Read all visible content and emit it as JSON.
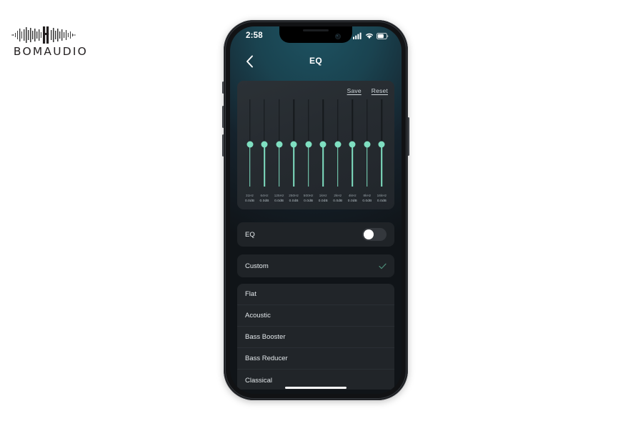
{
  "brand": {
    "name": "BOMAUDIO",
    "logo_icon": "audio-waveform-icon"
  },
  "phone": {
    "status_bar": {
      "time": "2:58",
      "icons": [
        "cellular-signal-icon",
        "wifi-icon",
        "battery-icon"
      ]
    },
    "nav": {
      "back_icon": "chevron-left-icon",
      "title": "EQ"
    }
  },
  "eq_panel": {
    "actions": [
      {
        "label": "Save",
        "name": "save-button"
      },
      {
        "label": "Reset",
        "name": "reset-button"
      }
    ],
    "thumb_color": "#7fdfc1",
    "track_active_color": "#7fdfc1",
    "track_inactive_color": "#15191c",
    "bands": [
      {
        "freq": "31Hz",
        "gain": "0.0dB",
        "value": 0
      },
      {
        "freq": "64Hz",
        "gain": "0.0dB",
        "value": 0
      },
      {
        "freq": "125Hz",
        "gain": "0.0dB",
        "value": 0
      },
      {
        "freq": "250Hz",
        "gain": "0.0dB",
        "value": 0
      },
      {
        "freq": "500Hz",
        "gain": "0.0dB",
        "value": 0
      },
      {
        "freq": "1kHz",
        "gain": "0.0dB",
        "value": 0
      },
      {
        "freq": "2kHz",
        "gain": "0.0dB",
        "value": 0
      },
      {
        "freq": "4kHz",
        "gain": "0.0dB",
        "value": 0
      },
      {
        "freq": "8kHz",
        "gain": "0.0dB",
        "value": 0
      },
      {
        "freq": "16kHz",
        "gain": "0.0dB",
        "value": 0
      }
    ]
  },
  "eq_toggle": {
    "label": "EQ",
    "state": "off"
  },
  "selected_preset": {
    "label": "Custom",
    "check_icon": "check-icon",
    "check_color": "#4d8c78"
  },
  "preset_list": {
    "items": [
      {
        "label": "Flat"
      },
      {
        "label": "Acoustic"
      },
      {
        "label": "Bass Booster"
      },
      {
        "label": "Bass Reducer"
      },
      {
        "label": "Classical"
      }
    ]
  }
}
